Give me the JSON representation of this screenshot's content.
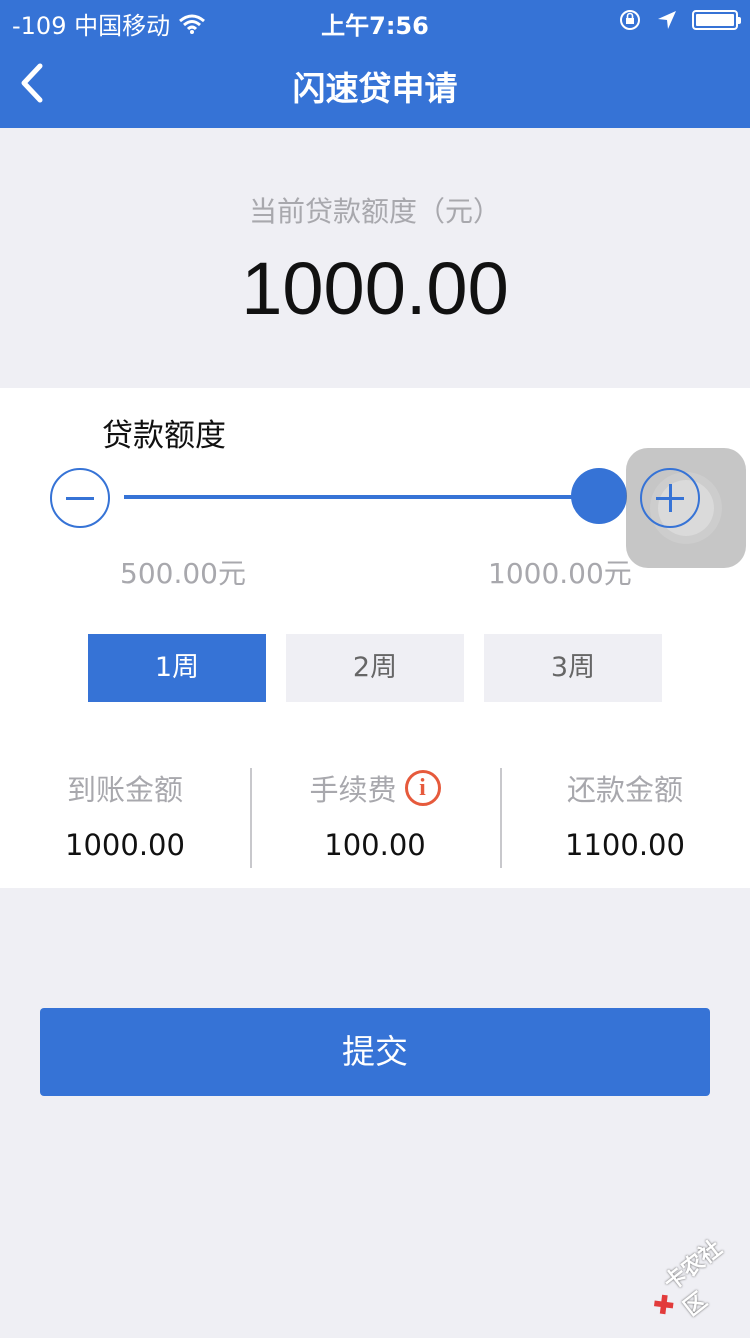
{
  "status_bar": {
    "signal": "-109 中国移动",
    "time": "上午7:56"
  },
  "nav": {
    "title": "闪速贷申请"
  },
  "header": {
    "amount_label": "当前贷款额度（元）",
    "amount_value": "1000.00"
  },
  "loan_slider": {
    "title": "贷款额度",
    "min_label": "500.00元",
    "max_label": "1000.00元",
    "value_fraction": 1.0
  },
  "terms": [
    {
      "label": "1周",
      "selected": true
    },
    {
      "label": "2周",
      "selected": false
    },
    {
      "label": "3周",
      "selected": false
    }
  ],
  "summary": {
    "received": {
      "label": "到账金额",
      "value": "1000.00"
    },
    "fee": {
      "label": "手续费",
      "value": "100.00"
    },
    "repay": {
      "label": "还款金额",
      "value": "1100.00"
    }
  },
  "submit_label": "提交",
  "watermark": "卡农社区",
  "colors": {
    "primary": "#3673d6",
    "background": "#efeff4",
    "info": "#e65a3c"
  }
}
